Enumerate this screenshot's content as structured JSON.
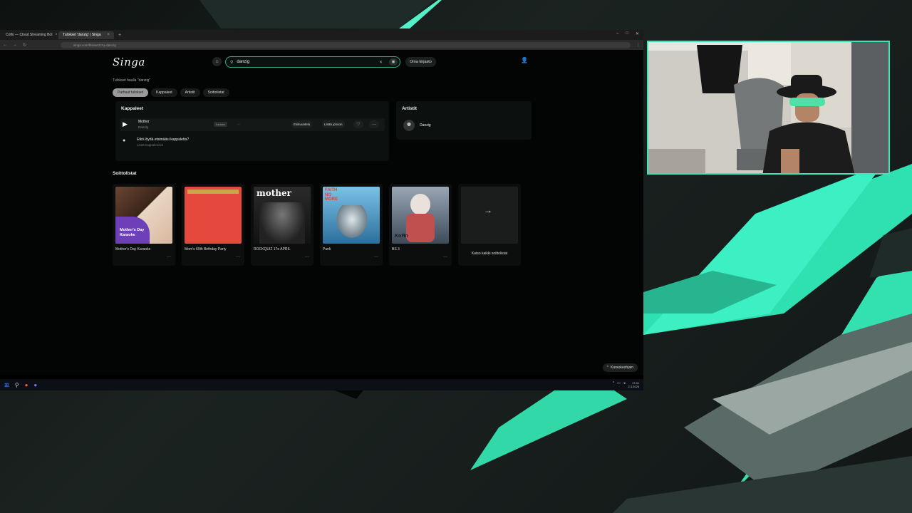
{
  "browser": {
    "tabs": [
      {
        "label": "Coflo — Cloud Streaming Bot",
        "active": false
      },
      {
        "label": "Tulokset 'danzig' | Singa",
        "active": true
      }
    ],
    "new_tab": "+",
    "url": "singa.com/fi/search?q=danzig"
  },
  "app": {
    "logo": "Singa",
    "search": {
      "value": "danzig",
      "placeholder": "Hae"
    },
    "login_label": "Oma kirjasto",
    "results_label": "Tulokset haulla \"danzig\"",
    "filters": [
      "Parhaat tulokset",
      "Kappaleet",
      "Artistit",
      "Soittolistat"
    ],
    "songs_title": "Kappaleet",
    "song": {
      "title": "Mother",
      "artist": "Danzig",
      "badge": "Karaoke",
      "preview_label": "Esikuuntelu",
      "queue_label": "Lisää jonoon"
    },
    "request": {
      "title": "Etkö löydä etsimääsi kappaletta?",
      "subtitle": "Lisää kappaletoive"
    },
    "artists_title": "Artistit",
    "artist": {
      "name": "Danzig"
    },
    "playlists_title": "Soittolistat",
    "playlists": [
      {
        "name": "Mother's Day Karaoke",
        "cover_text": "Mother's Day Karaoke"
      },
      {
        "name": "Mom's 60th Birthday Party",
        "cover_text": ""
      },
      {
        "name": "ROCKQUIZ 17e APRIL",
        "cover_text": "mother"
      },
      {
        "name": "Punk",
        "cover_text": "FAITH NO MORE"
      },
      {
        "name": "BS 3",
        "cover_text": "KoЯn"
      }
    ],
    "see_all_label": "Katso kaikki soittolistat",
    "karaoke_pill": "Karaokeohjain"
  },
  "taskbar": {
    "time": "17.41",
    "date": "2.3.2025"
  },
  "colors": {
    "accent": "#2fae7f",
    "webcam_border": "#3ee5b9",
    "page_bg": "#030504"
  }
}
